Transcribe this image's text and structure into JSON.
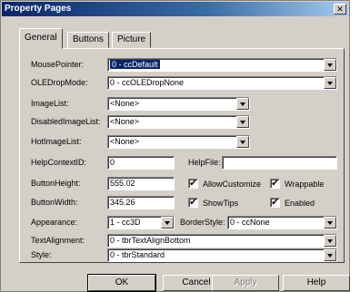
{
  "window": {
    "title": "Property Pages"
  },
  "tabs": [
    {
      "label": "General",
      "active": true
    },
    {
      "label": "Buttons",
      "active": false
    },
    {
      "label": "Picture",
      "active": false
    }
  ],
  "labels": {
    "mouse_pointer": "MousePointer:",
    "ole_drop_mode": "OLEDropMode:",
    "image_list": "ImageList:",
    "disabled_image_list": "DisabledImageList:",
    "hot_image_list": "HotImageList:",
    "help_context_id": "HelpContextID:",
    "help_file": "HelpFile:",
    "button_height": "ButtonHeight:",
    "button_width": "ButtonWidth:",
    "appearance": "Appearance:",
    "border_style": "BorderStyle:",
    "text_alignment": "TextAlignment:",
    "style": "Style:"
  },
  "values": {
    "mouse_pointer": "0 - ccDefault",
    "ole_drop_mode": "0 - ccOLEDropNone",
    "image_list": "<None>",
    "disabled_image_list": "<None>",
    "hot_image_list": "<None>",
    "help_context_id": "0",
    "help_file": "",
    "button_height": "555.02",
    "button_width": "345.26",
    "appearance": "1 - cc3D",
    "border_style": "0 - ccNone",
    "text_alignment": "0 - tbrTextAlignBottom",
    "style": "0 - tbrStandard"
  },
  "checkboxes": {
    "allow_customize": {
      "label": "AllowCustomize",
      "checked": true
    },
    "wrappable": {
      "label": "Wrappable",
      "checked": true
    },
    "show_tips": {
      "label": "ShowTips",
      "checked": true
    },
    "enabled": {
      "label": "Enabled",
      "checked": true
    }
  },
  "buttons": {
    "ok": "OK",
    "cancel": "Cancel",
    "apply": "Apply",
    "help": "Help"
  },
  "checkmark": "✔",
  "close_glyph": "✕"
}
